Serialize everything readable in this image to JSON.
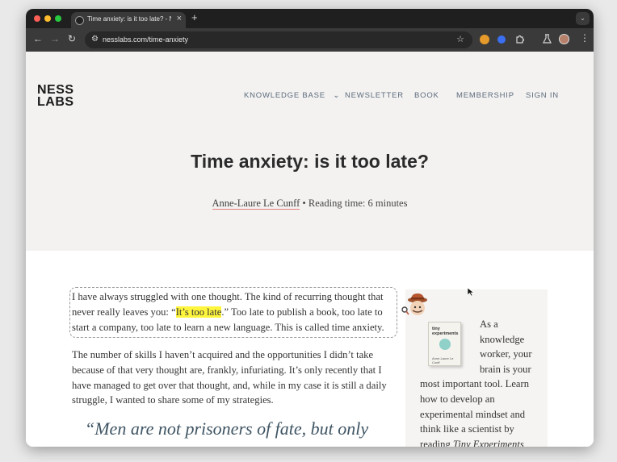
{
  "browser": {
    "tab_title": "Time anxiety: is it too late? - Ness Labs",
    "tab_close": "×",
    "new_tab": "+",
    "tab_menu_icon": "chevron-down-icon",
    "back_icon": "←",
    "forward_icon": "→",
    "reload_icon": "↻",
    "url": "nesslabs.com/time-anxiety",
    "star_icon": "☆",
    "menu_icon": "⋮",
    "extensions_icon": "puzzle-icon",
    "labs_icon": "flask-icon"
  },
  "site": {
    "logo_line1": "NESS",
    "logo_line2": "LABS",
    "nav": {
      "knowledge_base": "KNOWLEDGE BASE",
      "knowledge_base_caret": "⌄",
      "newsletter": "NEWSLETTER",
      "book": "BOOK",
      "membership": "MEMBERSHIP",
      "sign_in": "SIGN IN"
    }
  },
  "article": {
    "title": "Time anxiety: is it too late?",
    "author": "Anne-Laure Le Cunff",
    "separator": "•",
    "reading_time": "Reading time: 6 minutes",
    "lead_before": "I have always struggled with one thought. The kind of recurring thought that never really leaves you: “",
    "lead_highlight": "It’s too late",
    "lead_after": ".” Too late to publish a book, too late to start a company, too late to learn a new language. This is called time anxiety.",
    "paragraph2": "The number of skills I haven’t acquired and the opportunities I didn’t take because of that very thought are, frankly, infuriating. It’s only recently that I have managed to get over that thought, and, while in my case it is still a daily struggle, I wanted to share some of my strategies.",
    "quote": "“Men are not prisoners of fate, but only"
  },
  "sidebar": {
    "book_cover_title": "tiny experiments",
    "book_cover_author": "Anne-Laure Le Cunff",
    "promo_text": "As a knowledge worker, your brain is your most important tool. Learn how to develop an experimental mindset and think like a scientist by reading ",
    "promo_link": "Tiny Experiments"
  },
  "colors": {
    "highlight": "#fff53d",
    "author_underline": "#e57f7f",
    "nav_text": "#5d6b7c",
    "hero_bg": "#f3f2f1"
  }
}
